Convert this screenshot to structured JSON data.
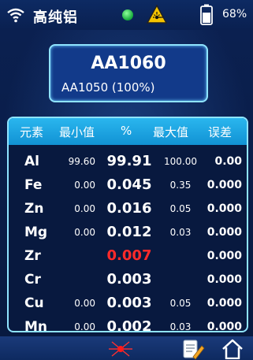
{
  "status_bar": {
    "title": "高纯铝",
    "battery": "68%",
    "icons": [
      "wifi-icon",
      "status-led",
      "laser-warning-icon",
      "battery-icon"
    ],
    "led_color": "#22c44a"
  },
  "grade": {
    "primary": "AA1060",
    "secondary": "AA1050 (100%)"
  },
  "table": {
    "headers": {
      "element": "元素",
      "min": "最小值",
      "percent": "%",
      "max": "最大值",
      "error": "误差"
    },
    "rows": [
      {
        "element": "Al",
        "min": "99.60",
        "percent": "99.91",
        "max": "100.00",
        "error": "0.00"
      },
      {
        "element": "Fe",
        "min": "0.00",
        "percent": "0.045",
        "max": "0.35",
        "error": "0.000"
      },
      {
        "element": "Zn",
        "min": "0.00",
        "percent": "0.016",
        "max": "0.05",
        "error": "0.000"
      },
      {
        "element": "Mg",
        "min": "0.00",
        "percent": "0.012",
        "max": "0.03",
        "error": "0.000"
      },
      {
        "element": "Zr",
        "min": "",
        "percent": "0.007",
        "max": "",
        "error": "0.000"
      },
      {
        "element": "Cr",
        "min": "",
        "percent": "0.003",
        "max": "",
        "error": "0.000"
      },
      {
        "element": "Cu",
        "min": "0.00",
        "percent": "0.003",
        "max": "0.05",
        "error": "0.000"
      },
      {
        "element": "Mn",
        "min": "0.00",
        "percent": "0.002",
        "max": "0.03",
        "error": "0.000"
      }
    ]
  },
  "bottom_bar": {
    "icons": [
      "laser-icon",
      "report-edit-icon",
      "home-icon"
    ]
  },
  "colors": {
    "accent": "#8fe4ff",
    "header": "#1a9ee0",
    "highlight_red": "#ff2a2a"
  }
}
